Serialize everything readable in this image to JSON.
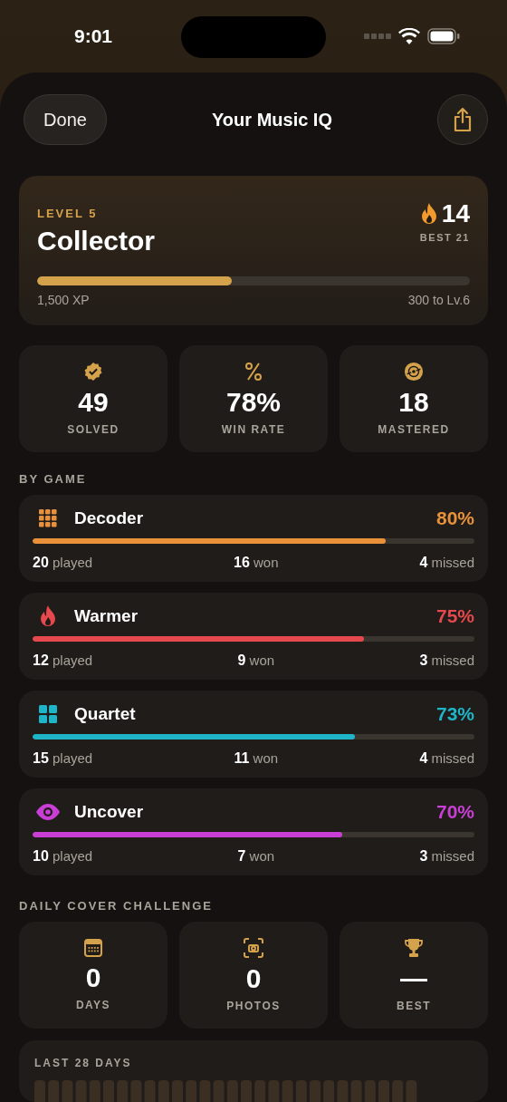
{
  "status_bar": {
    "time": "9:01"
  },
  "header": {
    "done_label": "Done",
    "title": "Your Music IQ"
  },
  "level_card": {
    "level_label": "LEVEL 5",
    "rank": "Collector",
    "streak": "14",
    "best": "BEST 21",
    "level": 0.45,
    "xp": "1,500 XP",
    "to_next": "300 to Lv.6"
  },
  "stats": [
    {
      "value": "49",
      "label": "SOLVED"
    },
    {
      "value": "78%",
      "label": "WIN RATE"
    },
    {
      "value": "18",
      "label": "MASTERED"
    }
  ],
  "by_game_heading": "BY GAME",
  "games": [
    {
      "name": "Decoder",
      "percent": "80%",
      "color": "#e8913a",
      "level": 0.8,
      "played": "20",
      "played_label": "played",
      "won": "16",
      "won_label": "won",
      "missed": "4",
      "missed_label": "missed"
    },
    {
      "name": "Warmer",
      "percent": "75%",
      "color": "#e5484d",
      "level": 0.75,
      "played": "12",
      "played_label": "played",
      "won": "9",
      "won_label": "won",
      "missed": "3",
      "missed_label": "missed"
    },
    {
      "name": "Quartet",
      "percent": "73%",
      "color": "#1fb5c9",
      "level": 0.73,
      "played": "15",
      "played_label": "played",
      "won": "11",
      "won_label": "won",
      "missed": "4",
      "missed_label": "missed"
    },
    {
      "name": "Uncover",
      "percent": "70%",
      "color": "#c93fd6",
      "level": 0.7,
      "played": "10",
      "played_label": "played",
      "won": "7",
      "won_label": "won",
      "missed": "3",
      "missed_label": "missed"
    }
  ],
  "daily_heading": "DAILY COVER CHALLENGE",
  "daily_stats": [
    {
      "value": "0",
      "label": "DAYS"
    },
    {
      "value": "0",
      "label": "PHOTOS"
    },
    {
      "value": "—",
      "label": "BEST"
    }
  ],
  "history": {
    "title": "LAST 28 DAYS"
  }
}
